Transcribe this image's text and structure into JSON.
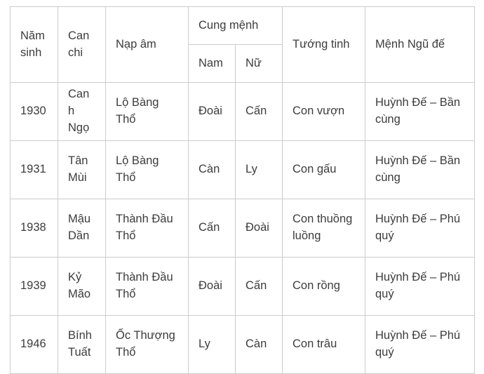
{
  "table": {
    "headers": {
      "nam_sinh": "Năm sinh",
      "can_chi": "Can chi",
      "nap_am": "Nạp âm",
      "cung_menh": "Cung mệnh",
      "cung_menh_nam": "Nam",
      "cung_menh_nu": "Nữ",
      "tuong_tinh": "Tướng tinh",
      "menh_ngu_de": "Mệnh Ngũ đế"
    },
    "rows": [
      {
        "nam_sinh": "1930",
        "can_chi": "Canh Ngọ",
        "nap_am": "Lộ Bàng Thổ",
        "cung_menh_nam": "Đoài",
        "cung_menh_nu": "Cấn",
        "tuong_tinh": "Con vượn",
        "menh_ngu_de": "Huỳnh Đế – Bần cùng"
      },
      {
        "nam_sinh": "1931",
        "can_chi": "Tân Mùi",
        "nap_am": "Lộ Bàng Thổ",
        "cung_menh_nam": "Càn",
        "cung_menh_nu": "Ly",
        "tuong_tinh": "Con gấu",
        "menh_ngu_de": "Huỳnh Đế – Bần cùng"
      },
      {
        "nam_sinh": "1938",
        "can_chi": "Mậu Dần",
        "nap_am": "Thành Đầu Thổ",
        "cung_menh_nam": "Cấn",
        "cung_menh_nu": "Đoài",
        "tuong_tinh": "Con thuồng luồng",
        "menh_ngu_de": "Huỳnh Đế – Phú quý"
      },
      {
        "nam_sinh": "1939",
        "can_chi": "Kỷ Mão",
        "nap_am": "Thành Đầu Thổ",
        "cung_menh_nam": "Đoài",
        "cung_menh_nu": "Cấn",
        "tuong_tinh": "Con rồng",
        "menh_ngu_de": "Huỳnh Đế – Phú quý"
      },
      {
        "nam_sinh": "1946",
        "can_chi": "Bính Tuất",
        "nap_am": "Ốc Thượng Thổ",
        "cung_menh_nam": "Ly",
        "cung_menh_nu": "Càn",
        "tuong_tinh": "Con trâu",
        "menh_ngu_de": "Huỳnh Đế – Phú quý"
      }
    ]
  },
  "colors": {
    "text": "#3c3c3c",
    "border": "#cccccc",
    "background": "#ffffff"
  }
}
